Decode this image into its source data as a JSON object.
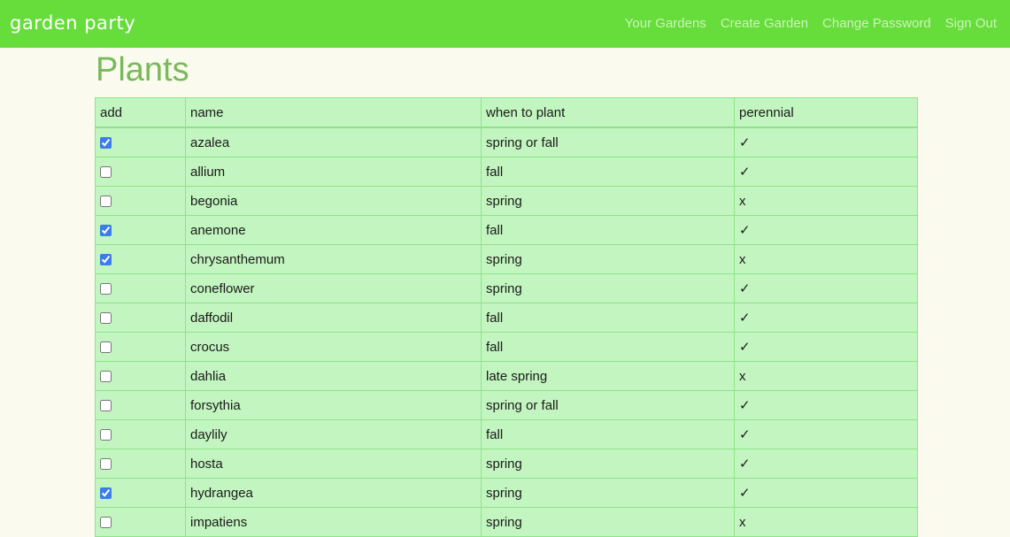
{
  "nav": {
    "brand": "garden party",
    "links": [
      "Your Gardens",
      "Create Garden",
      "Change Password",
      "Sign Out"
    ]
  },
  "page": {
    "title": "Plants"
  },
  "table": {
    "headers": [
      "add",
      "name",
      "when to plant",
      "perennial"
    ],
    "rows": [
      {
        "checked": true,
        "name": "azalea",
        "when": "spring or fall",
        "perennial": "✓"
      },
      {
        "checked": false,
        "name": "allium",
        "when": "fall",
        "perennial": "✓"
      },
      {
        "checked": false,
        "name": "begonia",
        "when": "spring",
        "perennial": "x"
      },
      {
        "checked": true,
        "name": "anemone",
        "when": "fall",
        "perennial": "✓"
      },
      {
        "checked": true,
        "name": "chrysanthemum",
        "when": "spring",
        "perennial": "x"
      },
      {
        "checked": false,
        "name": "coneflower",
        "when": "spring",
        "perennial": "✓"
      },
      {
        "checked": false,
        "name": "daffodil",
        "when": "fall",
        "perennial": "✓"
      },
      {
        "checked": false,
        "name": "crocus",
        "when": "fall",
        "perennial": "✓"
      },
      {
        "checked": false,
        "name": "dahlia",
        "when": "late spring",
        "perennial": "x"
      },
      {
        "checked": false,
        "name": "forsythia",
        "when": "spring or fall",
        "perennial": "✓"
      },
      {
        "checked": false,
        "name": "daylily",
        "when": "fall",
        "perennial": "✓"
      },
      {
        "checked": false,
        "name": "hosta",
        "when": "spring",
        "perennial": "✓"
      },
      {
        "checked": true,
        "name": "hydrangea",
        "when": "spring",
        "perennial": "✓"
      },
      {
        "checked": false,
        "name": "impatiens",
        "when": "spring",
        "perennial": "x"
      }
    ]
  }
}
